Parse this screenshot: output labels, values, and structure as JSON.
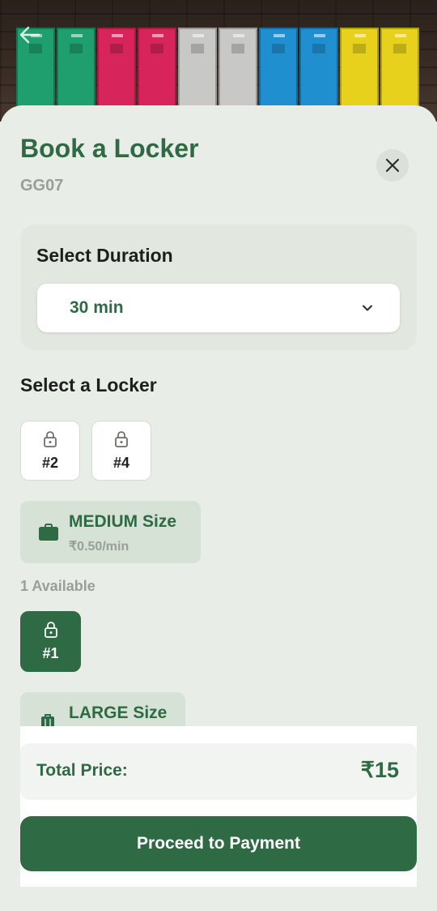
{
  "header": {
    "back_icon": "arrow-left-icon",
    "locker_colors": [
      "#1f9e6e",
      "#d7245a",
      "#c8c9c6",
      "#1f8fd0",
      "#e7d11d"
    ]
  },
  "sheet": {
    "title": "Book a Locker",
    "location_code": "GG07",
    "close_icon": "close-icon"
  },
  "duration": {
    "label": "Select Duration",
    "selected": "30 min",
    "dropdown_icon": "chevron-down-icon"
  },
  "lockers": {
    "heading": "Select a Locker",
    "small_lockers": [
      {
        "label": "#2",
        "icon": "lock-icon"
      },
      {
        "label": "#4",
        "icon": "lock-icon"
      }
    ],
    "medium": {
      "name": "MEDIUM Size",
      "price": "₹0.50/min",
      "icon": "briefcase-icon",
      "available": "1 Available",
      "lockers": [
        {
          "label": "#1",
          "icon": "lock-icon",
          "selected": true
        }
      ]
    },
    "large": {
      "name": "LARGE Size",
      "icon": "luggage-icon"
    }
  },
  "summary": {
    "total_label": "Total Price:",
    "total_value": "₹15",
    "pay_button": "Proceed to Payment"
  },
  "colors": {
    "primary": "#2e6a44",
    "background": "#e9ede7",
    "muted": "#9a9e99"
  }
}
